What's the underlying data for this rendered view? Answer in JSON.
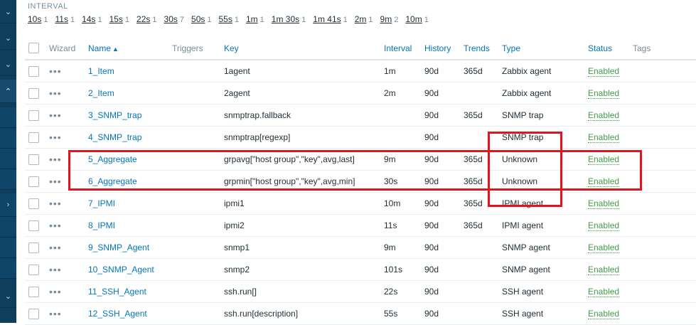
{
  "sidebar": {
    "buttons": [
      {
        "icon": "chevron-down-icon",
        "glyph": "⌄"
      },
      {
        "icon": "chevron-down-icon",
        "glyph": "⌄"
      },
      {
        "icon": "chevron-down-icon",
        "glyph": "⌄"
      },
      {
        "icon": "chevron-up-icon",
        "glyph": "⌃"
      },
      {
        "icon": "chevron-right-icon",
        "glyph": "›"
      },
      {
        "icon": "chevron-down-icon",
        "glyph": "⌄"
      }
    ]
  },
  "interval_filter": {
    "title": "INTERVAL",
    "items": [
      {
        "label": "10s",
        "count": "1"
      },
      {
        "label": "11s",
        "count": "1"
      },
      {
        "label": "14s",
        "count": "1"
      },
      {
        "label": "15s",
        "count": "1"
      },
      {
        "label": "22s",
        "count": "1"
      },
      {
        "label": "30s",
        "count": "7"
      },
      {
        "label": "50s",
        "count": "1"
      },
      {
        "label": "55s",
        "count": "1"
      },
      {
        "label": "1m",
        "count": "1"
      },
      {
        "label": "1m 30s",
        "count": "1"
      },
      {
        "label": "1m 41s",
        "count": "1"
      },
      {
        "label": "2m",
        "count": "1"
      },
      {
        "label": "9m",
        "count": "2"
      },
      {
        "label": "10m",
        "count": "1"
      }
    ]
  },
  "table": {
    "headers": {
      "wizard": "Wizard",
      "name": "Name",
      "name_sort": "▲",
      "triggers": "Triggers",
      "key": "Key",
      "interval": "Interval",
      "history": "History",
      "trends": "Trends",
      "type": "Type",
      "status": "Status",
      "tags": "Tags"
    },
    "wizard_glyph": "•••",
    "rows": [
      {
        "name": "1_Item",
        "key": "1agent",
        "interval": "1m",
        "history": "90d",
        "trends": "365d",
        "type": "Zabbix agent",
        "status": "Enabled"
      },
      {
        "name": "2_Item",
        "key": "2agent",
        "interval": "2m",
        "history": "90d",
        "trends": "",
        "type": "Zabbix agent",
        "status": "Enabled"
      },
      {
        "name": "3_SNMP_trap",
        "key": "snmptrap.fallback",
        "interval": "",
        "history": "90d",
        "trends": "365d",
        "type": "SNMP trap",
        "status": "Enabled"
      },
      {
        "name": "4_SNMP_trap",
        "key": "snmptrap[regexp]",
        "interval": "",
        "history": "90d",
        "trends": "",
        "type": "SNMP trap",
        "status": "Enabled"
      },
      {
        "name": "5_Aggregate",
        "key": "grpavg[\"host group\",\"key\",avg,last]",
        "interval": "9m",
        "history": "90d",
        "trends": "365d",
        "type": "Unknown",
        "status": "Enabled"
      },
      {
        "name": "6_Aggregate",
        "key": "grpmin[\"host group\",\"key\",avg,min]",
        "interval": "30s",
        "history": "90d",
        "trends": "365d",
        "type": "Unknown",
        "status": "Enabled"
      },
      {
        "name": "7_IPMI",
        "key": "ipmi1",
        "interval": "10m",
        "history": "90d",
        "trends": "365d",
        "type": "IPMI agent",
        "status": "Enabled"
      },
      {
        "name": "8_IPMI",
        "key": "ipmi2",
        "interval": "11s",
        "history": "90d",
        "trends": "365d",
        "type": "IPMI agent",
        "status": "Enabled"
      },
      {
        "name": "9_SNMP_Agent",
        "key": "snmp1",
        "interval": "9m",
        "history": "90d",
        "trends": "",
        "type": "SNMP agent",
        "status": "Enabled"
      },
      {
        "name": "10_SNMP_Agent",
        "key": "snmp2",
        "interval": "101s",
        "history": "90d",
        "trends": "",
        "type": "SNMP agent",
        "status": "Enabled"
      },
      {
        "name": "11_SSH_Agent",
        "key": "ssh.run[]",
        "interval": "22s",
        "history": "90d",
        "trends": "",
        "type": "SSH agent",
        "status": "Enabled"
      },
      {
        "name": "12_SSH_Agent",
        "key": "ssh.run[description]",
        "interval": "55s",
        "history": "90d",
        "trends": "",
        "type": "SSH agent",
        "status": "Enabled"
      }
    ]
  },
  "highlight_color": "#e0161c"
}
